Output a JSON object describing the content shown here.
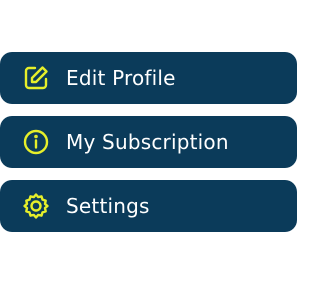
{
  "colors": {
    "background": "#ffffff",
    "item_background": "#0b3b5a",
    "accent": "#e6ef2a",
    "text": "#ffffff"
  },
  "menu": {
    "items": [
      {
        "label": "Edit Profile",
        "icon": "edit-icon"
      },
      {
        "label": "My Subscription",
        "icon": "info-icon"
      },
      {
        "label": "Settings",
        "icon": "gear-icon"
      }
    ]
  }
}
